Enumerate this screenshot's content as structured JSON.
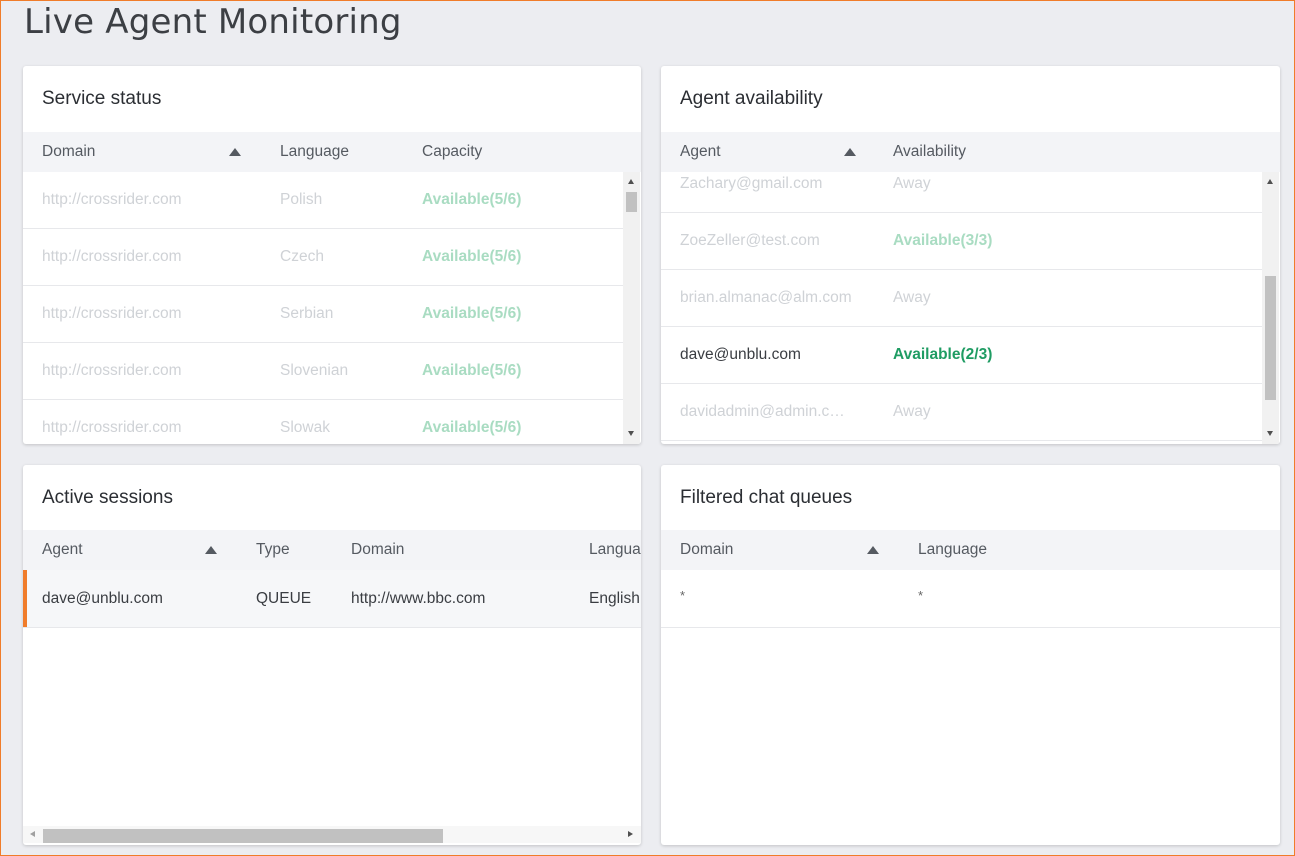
{
  "page": {
    "title": "Live Agent Monitoring"
  },
  "service_status": {
    "title": "Service status",
    "columns": [
      "Domain",
      "Language",
      "Capacity"
    ],
    "rows": [
      {
        "domain": "http://crossrider.com",
        "language": "Polish",
        "capacity": "Available(5/6)"
      },
      {
        "domain": "http://crossrider.com",
        "language": "Czech",
        "capacity": "Available(5/6)"
      },
      {
        "domain": "http://crossrider.com",
        "language": "Serbian",
        "capacity": "Available(5/6)"
      },
      {
        "domain": "http://crossrider.com",
        "language": "Slovenian",
        "capacity": "Available(5/6)"
      },
      {
        "domain": "http://crossrider.com",
        "language": "Slowak",
        "capacity": "Available(5/6)"
      }
    ]
  },
  "agent_availability": {
    "title": "Agent availability",
    "columns": [
      "Agent",
      "Availability"
    ],
    "rows": [
      {
        "agent": "Zachary@gmail.com",
        "availability": "Away"
      },
      {
        "agent": "ZoeZeller@test.com",
        "availability": "Available(3/3)"
      },
      {
        "agent": "brian.almanac@alm.com",
        "availability": "Away"
      },
      {
        "agent": "dave@unblu.com",
        "availability": "Available(2/3)"
      },
      {
        "agent": "davidadmin@admin.c…",
        "availability": "Away"
      }
    ]
  },
  "active_sessions": {
    "title": "Active sessions",
    "columns": [
      "Agent",
      "Type",
      "Domain",
      "Languag"
    ],
    "rows": [
      {
        "agent": "dave@unblu.com",
        "type": "QUEUE",
        "domain": "http://www.bbc.com",
        "language": "English"
      }
    ]
  },
  "filtered_chat_queues": {
    "title": "Filtered chat queues",
    "columns": [
      "Domain",
      "Language"
    ],
    "rows": [
      {
        "domain": "*",
        "language": "*"
      }
    ]
  },
  "colors": {
    "accent": "#f07c2a",
    "available": "#1f9c63",
    "header_bg": "#f3f4f7",
    "page_bg": "#ecedf1"
  },
  "icons": [
    "sort-ascending-icon",
    "scroll-up-arrow-icon",
    "scroll-down-arrow-icon",
    "scroll-left-arrow-icon",
    "scroll-right-arrow-icon"
  ]
}
